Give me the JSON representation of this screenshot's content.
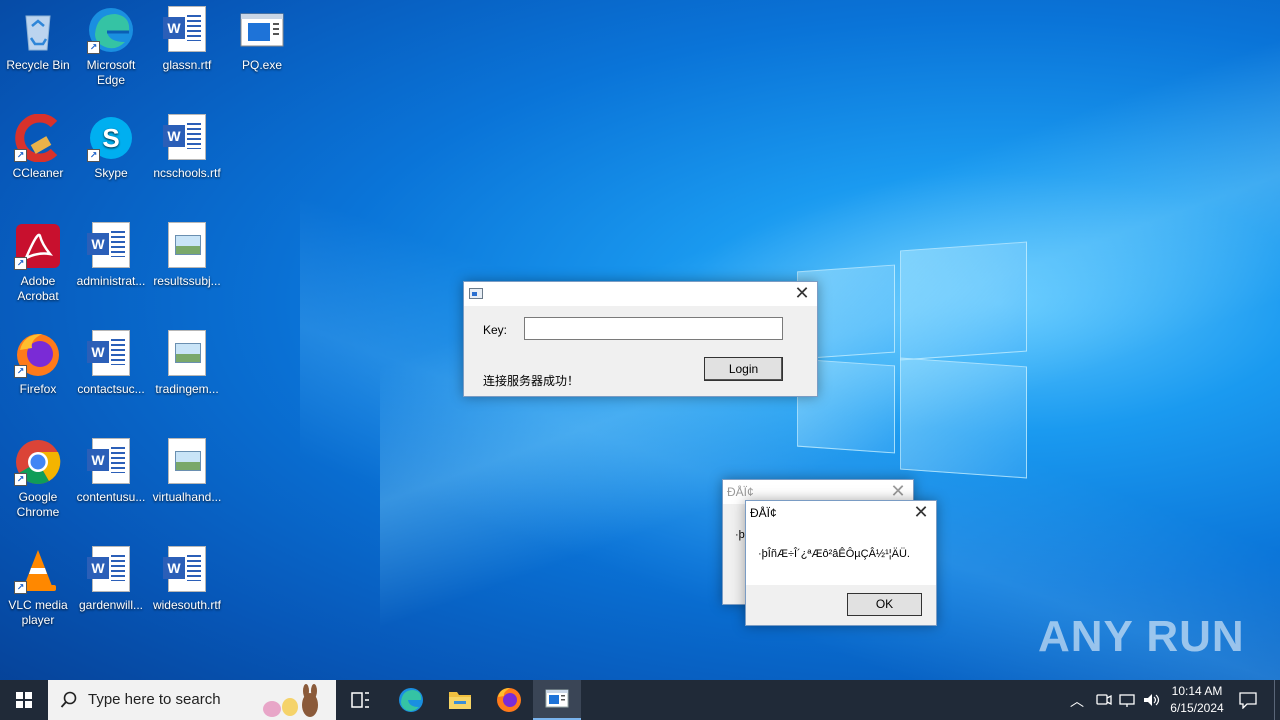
{
  "desktop_icons": [
    {
      "label": "Recycle Bin",
      "icon": "recycle-bin-icon"
    },
    {
      "label": "Microsoft Edge",
      "icon": "edge-icon"
    },
    {
      "label": "glassn.rtf",
      "icon": "word-doc-icon"
    },
    {
      "label": "PQ.exe",
      "icon": "exe-window-icon"
    },
    {
      "label": "CCleaner",
      "icon": "ccleaner-icon"
    },
    {
      "label": "Skype",
      "icon": "skype-icon"
    },
    {
      "label": "ncschools.rtf",
      "icon": "word-doc-icon"
    },
    {
      "label": "Adobe Acrobat",
      "icon": "acrobat-icon"
    },
    {
      "label": "administrat...",
      "icon": "word-doc-icon"
    },
    {
      "label": "resultssubj...",
      "icon": "image-file-icon"
    },
    {
      "label": "Firefox",
      "icon": "firefox-icon"
    },
    {
      "label": "contactsuc...",
      "icon": "word-doc-icon"
    },
    {
      "label": "tradingem...",
      "icon": "image-file-icon"
    },
    {
      "label": "Google Chrome",
      "icon": "chrome-icon"
    },
    {
      "label": "contentusu...",
      "icon": "word-doc-icon"
    },
    {
      "label": "virtualhand...",
      "icon": "image-file-icon"
    },
    {
      "label": "VLC media player",
      "icon": "vlc-icon"
    },
    {
      "label": "gardenwill...",
      "icon": "word-doc-icon"
    },
    {
      "label": "widesouth.rtf",
      "icon": "word-doc-icon"
    }
  ],
  "login_dialog": {
    "title": "",
    "key_label": "Key:",
    "key_value": "",
    "status_text": "连接服务器成功！",
    "login_button": "Login"
  },
  "back_message": {
    "title": "ÐÅÏ¢",
    "text": "·þ"
  },
  "front_message": {
    "title": "ÐÅÏ¢",
    "text": "·þÎñÆ÷Î´¿ªÆô²âÊÔµÇÂ½¹¦ÄÜ.",
    "ok_button": "OK"
  },
  "taskbar": {
    "search_placeholder": "Type here to search",
    "time": "10:14 AM",
    "date": "6/15/2024"
  },
  "watermark": "ANY RUN"
}
